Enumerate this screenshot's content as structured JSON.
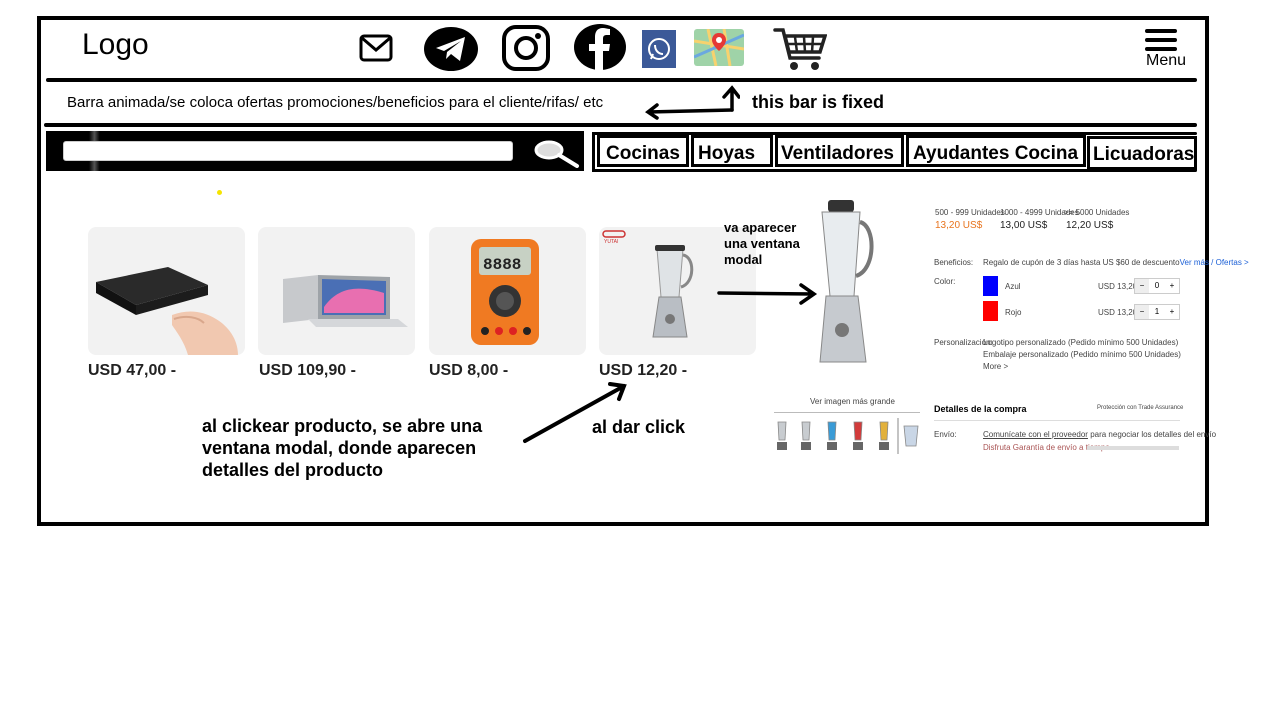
{
  "header": {
    "logo": "Logo",
    "social_icons": [
      "mail-icon",
      "telegram-icon",
      "instagram-icon",
      "facebook-icon",
      "whatsapp-icon",
      "map-icon",
      "cart-icon"
    ],
    "menu_label": "Menu"
  },
  "promo_bar": {
    "text": "Barra animada/se coloca ofertas promociones/beneficios para el cliente/rifas/ etc",
    "note": "this bar is fixed"
  },
  "search": {
    "placeholder": ""
  },
  "categories": [
    "Cocinas",
    "Hoyas",
    "Ventiladores",
    "Ayudantes Cocina",
    "Licuadoras"
  ],
  "products": [
    {
      "image": "mini-pc",
      "price": "USD 47,00 -"
    },
    {
      "image": "laptop",
      "price": "USD 109,90 -"
    },
    {
      "image": "multimeter",
      "price": "USD 8,00 -"
    },
    {
      "image": "blender",
      "price": "USD 12,20 -"
    }
  ],
  "annotations": {
    "click_product": "al clickear producto, se abre una ventana modal, donde aparecen detalles del producto",
    "click_product_lines": [
      "al clickear producto, se abre una",
      "ventana modal, donde aparecen",
      "detalles del producto"
    ],
    "al_dar_click": "al dar click",
    "modal_note_lines": [
      "va aparecer",
      "una ventana",
      "modal"
    ]
  },
  "modal_preview": {
    "tiers": [
      {
        "range": "500 - 999 Unidades",
        "price": "13,20 US$"
      },
      {
        "range": "1000 - 4999 Unidades",
        "price": "13,00 US$"
      },
      {
        "range": ">= 5000 Unidades",
        "price": "12,20 US$"
      }
    ],
    "beneficios_label": "Beneficios:",
    "beneficios_text": "Regalo de cupón de 3 días hasta US $60 de descuento",
    "beneficios_link": "Ver más / Ofertas >",
    "color_label": "Color:",
    "colors": [
      {
        "name": "Azul",
        "hex": "#0000ff",
        "price": "USD 13,20",
        "qty": "0"
      },
      {
        "name": "Rojo",
        "hex": "#ff0000",
        "price": "USD 13,20",
        "qty": "1"
      }
    ],
    "personalizacion_label": "Personalización:",
    "personalizacion_lines": [
      "Logotipo personalizado (Pedido mínimo 500 Unidades)",
      "Embalaje personalizado (Pedido mínimo 500 Unidades)",
      "More >"
    ],
    "view_larger": "Ver imagen más grande",
    "purchase_details": "Detalles de la compra",
    "protection": "Protección con  Trade Assurance",
    "envio_label": "Envío:",
    "envio_link": "Comunícate con el proveedor",
    "envio_text": "para negociar los detalles del envío",
    "entrega": "Disfruta Garantía de envío a tiempo"
  }
}
